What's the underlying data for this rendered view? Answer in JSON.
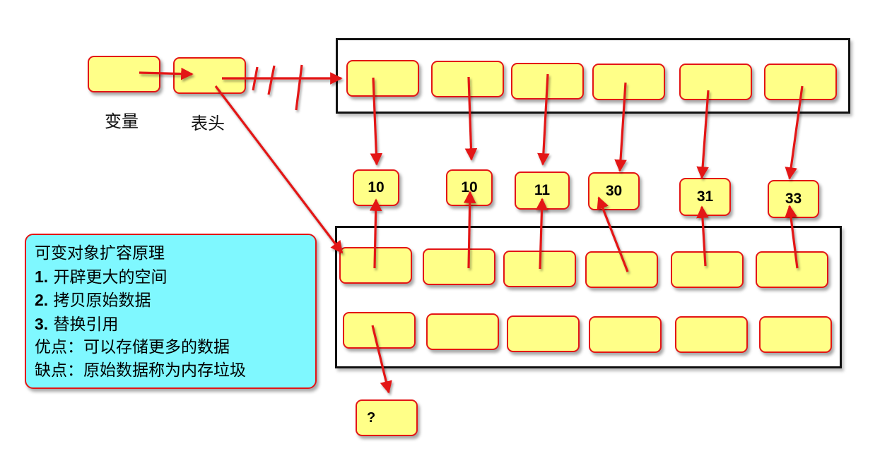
{
  "labels": {
    "variable": "变量",
    "head": "表头"
  },
  "values": [
    "10",
    "10",
    "11",
    "30",
    "31",
    "33"
  ],
  "unknown_value": "?",
  "note": {
    "title": "可变对象扩容原理",
    "steps": [
      {
        "num": "1.",
        "text": " 开辟更大的空间"
      },
      {
        "num": "2.",
        "text": " 拷贝原始数据"
      },
      {
        "num": "3.",
        "text": " 替换引用"
      }
    ],
    "pros": "优点：可以存储更多的数据",
    "cons": "缺点：原始数据称为内存垃圾"
  },
  "colors": {
    "cell_fill": "#ffff88",
    "cell_border": "#e31515",
    "arrow": "#e31515",
    "note_fill": "#7ff8ff",
    "frame": "#111111"
  }
}
